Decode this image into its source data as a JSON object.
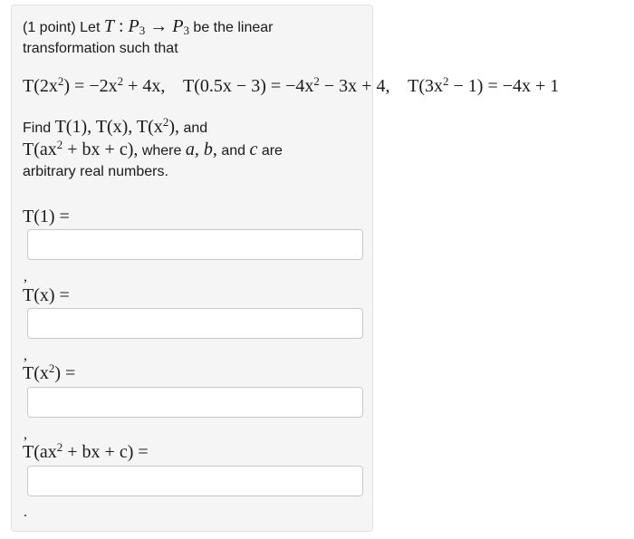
{
  "problem": {
    "intro_prefix": "(1 point) Let",
    "intro_suffix": "be the linear",
    "intro_line2": "transformation such that",
    "map_T": "T",
    "map_colon": ":",
    "map_P": "P",
    "map_sub": "3",
    "map_arrow": "→",
    "eq1_lhs_a": "T(2x",
    "eq1_lhs_b": ") = −2x",
    "eq1_rhs": " + 4x,",
    "eq2": "T(0.5x − 3) = −4x",
    "eq2_rhs": " − 3x + 4,",
    "eq3_a": "T(3x",
    "eq3_b": " − 1) = −4x + 1",
    "exp2": "2",
    "find_prefix": "Find",
    "find_terms": "T(1), T(x), T(x",
    "find_terms_end": "),",
    "find_and": "and",
    "line2_math_a": "T(ax",
    "line2_math_b": " + bx + c),",
    "line2_where": "where",
    "var_a": "a,",
    "var_b": "b,",
    "and2": "and",
    "var_c": "c",
    "are": "are",
    "line3": "arbitrary real numbers."
  },
  "answers": [
    {
      "label_a": "T(1) =",
      "label_b": "",
      "value": ""
    },
    {
      "label_a": "T(x) =",
      "label_b": "",
      "value": ""
    },
    {
      "label_a": "T(x",
      "label_b": ") =",
      "value": ""
    },
    {
      "label_a": "T(ax",
      "label_b": " + bx + c) =",
      "value": ""
    }
  ],
  "separator": ",",
  "end_mark": "."
}
